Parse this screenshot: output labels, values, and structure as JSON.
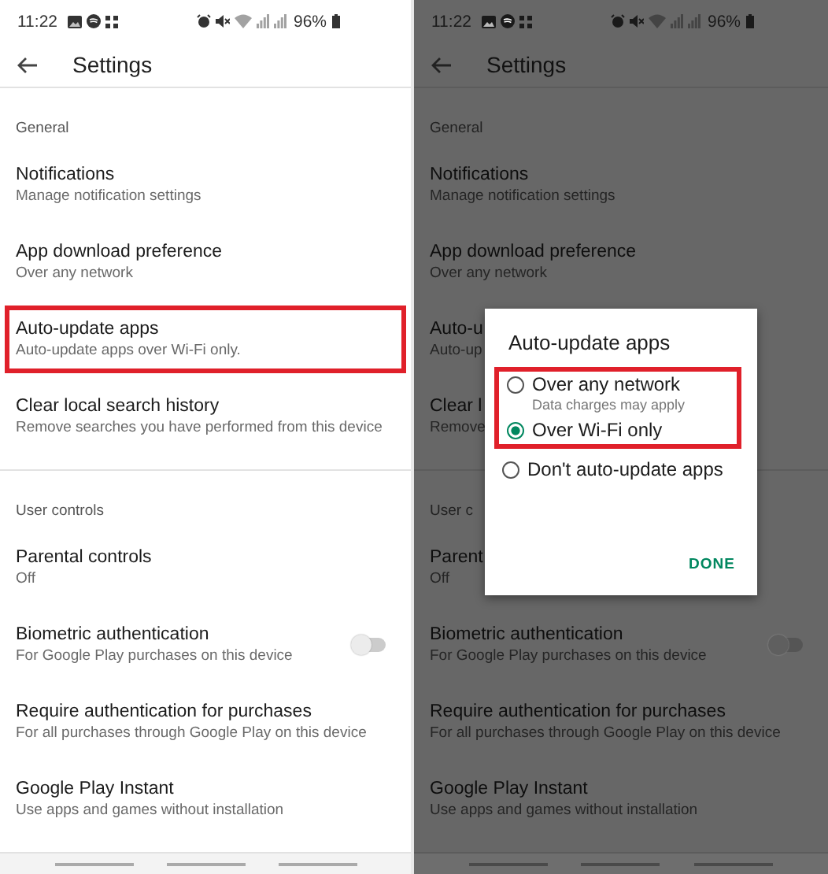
{
  "screens": [
    {
      "dimmed": false,
      "status_bar": {
        "time": "11:22",
        "battery": "96%"
      },
      "title": "Settings",
      "sections": [
        {
          "header": "General",
          "items": [
            {
              "title": "Notifications",
              "subtitle": "Manage notification settings",
              "highlighted": false
            },
            {
              "title": "App download preference",
              "subtitle": "Over any network",
              "highlighted": false
            },
            {
              "title": "Auto-update apps",
              "subtitle": "Auto-update apps over Wi-Fi only.",
              "highlighted": true
            },
            {
              "title": "Clear local search history",
              "subtitle": "Remove searches you have performed from this device",
              "highlighted": false
            }
          ]
        },
        {
          "header": "User controls",
          "items": [
            {
              "title": "Parental controls",
              "subtitle": "Off",
              "highlighted": false
            },
            {
              "title": "Biometric authentication",
              "subtitle": "For Google Play purchases on this device",
              "highlighted": false,
              "kind": "toggle",
              "on": false
            },
            {
              "title": "Require authentication for purchases",
              "subtitle": "For all purchases through Google Play on this device",
              "highlighted": false
            },
            {
              "title": "Google Play Instant",
              "subtitle": "Use apps and games without installation",
              "highlighted": false
            }
          ]
        }
      ]
    },
    {
      "dimmed": true,
      "status_bar": {
        "time": "11:22",
        "battery": "96%"
      },
      "title": "Settings",
      "sections": [
        {
          "header": "General",
          "items": [
            {
              "title": "Notifications",
              "subtitle": "Manage notification settings",
              "highlighted": false
            },
            {
              "title": "App download preference",
              "subtitle": "Over any network",
              "highlighted": false
            },
            {
              "title": "Auto-u",
              "subtitle": "Auto-up",
              "highlighted": false
            },
            {
              "title": "Clear l",
              "subtitle": "Remove",
              "highlighted": false
            }
          ]
        },
        {
          "header": "User c",
          "items": [
            {
              "title": "Parent",
              "subtitle": "Off",
              "highlighted": false
            },
            {
              "title": "Biometric authentication",
              "subtitle": "For Google Play purchases on this device",
              "highlighted": false,
              "kind": "toggle",
              "on": false
            },
            {
              "title": "Require authentication for purchases",
              "subtitle": "For all purchases through Google Play on this device",
              "highlighted": false
            },
            {
              "title": "Google Play Instant",
              "subtitle": "Use apps and games without installation",
              "highlighted": false
            }
          ]
        }
      ],
      "dialog": {
        "title": "Auto-update apps",
        "options": [
          {
            "label": "Over any network",
            "subtitle": "Data charges may apply",
            "selected": false,
            "highlighted": true
          },
          {
            "label": "Over Wi-Fi only",
            "selected": true,
            "highlighted": true
          },
          {
            "label": "Don't auto-update apps",
            "selected": false,
            "highlighted": false
          }
        ],
        "button": "DONE"
      }
    }
  ]
}
